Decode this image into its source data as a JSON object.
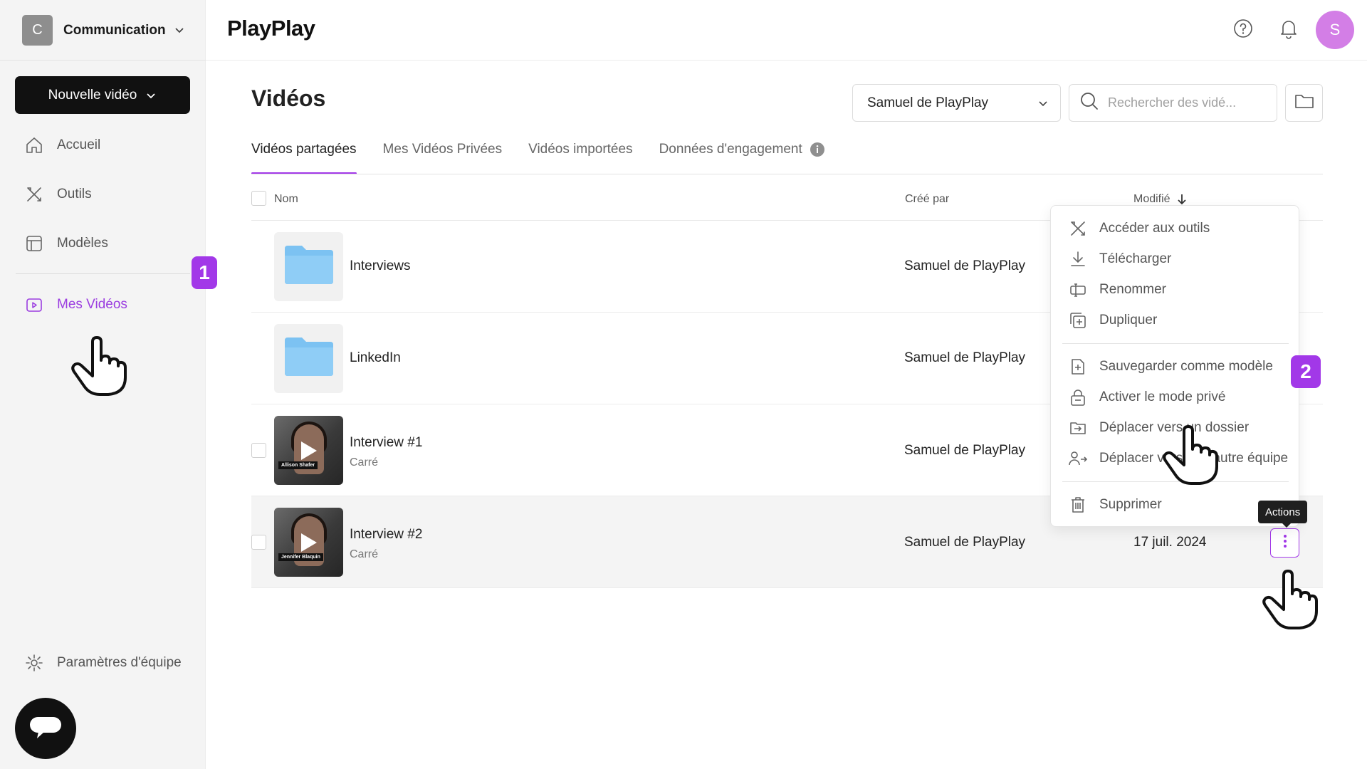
{
  "sidebar": {
    "team_initial": "C",
    "team_name": "Communication",
    "new_video_label": "Nouvelle vidéo",
    "nav": [
      {
        "label": "Accueil",
        "icon": "home-icon"
      },
      {
        "label": "Outils",
        "icon": "tools-icon"
      },
      {
        "label": "Modèles",
        "icon": "templates-icon"
      },
      {
        "label": "Mes Vidéos",
        "icon": "my-videos-icon",
        "active": true
      }
    ],
    "settings_label": "Paramètres d'équipe",
    "step_badge": "1"
  },
  "header": {
    "logo": "PlayPlay",
    "user_initial": "S"
  },
  "main": {
    "title": "Vidéos",
    "owner_filter": "Samuel de PlayPlay",
    "search_placeholder": "Rechercher des vidé...",
    "tabs": [
      {
        "label": "Vidéos partagées",
        "active": true
      },
      {
        "label": "Mes Vidéos Privées"
      },
      {
        "label": "Vidéos importées"
      },
      {
        "label": "Données d'engagement"
      }
    ],
    "columns": {
      "name": "Nom",
      "creator": "Créé par",
      "modified": "Modifié"
    },
    "rows": [
      {
        "name": "Interviews",
        "type": "folder",
        "creator": "Samuel de PlayPlay"
      },
      {
        "name": "LinkedIn",
        "type": "folder",
        "creator": "Samuel de PlayPlay"
      },
      {
        "name": "Interview #1",
        "subtitle": "Carré",
        "type": "video",
        "creator": "Samuel de PlayPlay",
        "thumb_tag": "Allison Shafer"
      },
      {
        "name": "Interview #2",
        "subtitle": "Carré",
        "type": "video",
        "creator": "Samuel de PlayPlay",
        "modified": "17 juil. 2024",
        "thumb_tag": "Jennifer Blaquin"
      }
    ]
  },
  "menu": {
    "items": [
      {
        "label": "Accéder aux outils",
        "icon": "tools-icon"
      },
      {
        "label": "Télécharger",
        "icon": "download-icon"
      },
      {
        "label": "Renommer",
        "icon": "rename-icon"
      },
      {
        "label": "Dupliquer",
        "icon": "duplicate-icon"
      },
      {
        "label": "Sauvegarder comme modèle",
        "icon": "save-template-icon"
      },
      {
        "label": "Activer le mode privé",
        "icon": "lock-icon"
      },
      {
        "label": "Déplacer vers un dossier",
        "icon": "move-folder-icon"
      },
      {
        "label": "Déplacer vers une autre équipe",
        "icon": "move-team-icon"
      },
      {
        "label": "Supprimer",
        "icon": "trash-icon"
      }
    ],
    "step_badge": "2"
  },
  "tooltip": "Actions",
  "colors": {
    "accent": "#a238e8",
    "primary_button": "#111111",
    "avatar": "#d37ee6",
    "folder": "#7cc2f2"
  }
}
